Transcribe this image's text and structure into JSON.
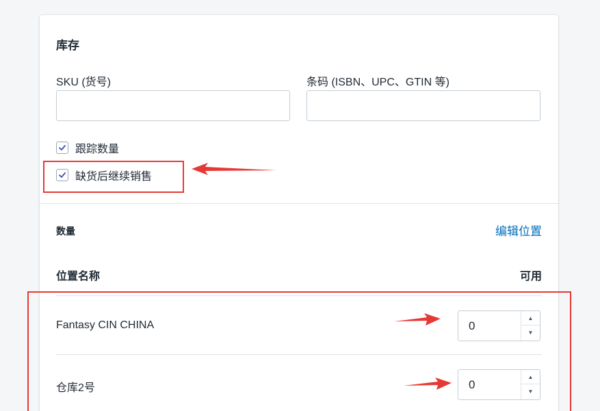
{
  "inventory": {
    "title": "库存",
    "sku_label": "SKU (货号)",
    "sku_value": "",
    "barcode_label": "条码 (ISBN、UPC、GTIN 等)",
    "barcode_value": "",
    "track_quantity_label": "跟踪数量",
    "track_quantity_checked": true,
    "continue_selling_label": "缺货后继续销售",
    "continue_selling_checked": true
  },
  "quantity": {
    "section_label": "数量",
    "edit_locations_label": "编辑位置",
    "col_location": "位置名称",
    "col_available": "可用",
    "locations": [
      {
        "name": "Fantasy CIN CHINA",
        "available": "0"
      },
      {
        "name": "仓库2号",
        "available": "0"
      }
    ]
  },
  "colors": {
    "link": "#006fbb",
    "annotation_red": "#e53935",
    "border": "#c4cdd5"
  },
  "icons": {
    "checkbox": "check-icon",
    "stepper_up": "caret-up-icon",
    "stepper_down": "caret-down-icon"
  }
}
